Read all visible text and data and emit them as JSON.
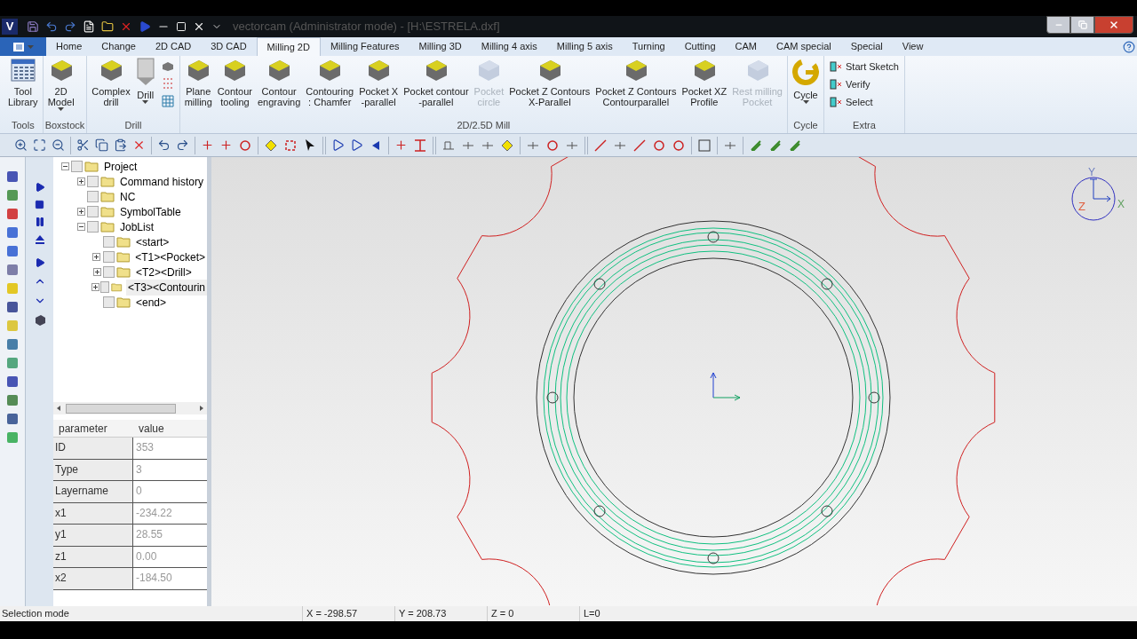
{
  "title_bar": {
    "app_letter": "V",
    "title": "vectorcam (Administrator mode) - [H:\\ESTRELA.dxf]"
  },
  "tabs": [
    {
      "label": "Home",
      "selected": false
    },
    {
      "label": "Change",
      "selected": false
    },
    {
      "label": "2D CAD",
      "selected": false
    },
    {
      "label": "3D CAD",
      "selected": false
    },
    {
      "label": "Milling 2D",
      "selected": true
    },
    {
      "label": "Milling Features",
      "selected": false
    },
    {
      "label": "Milling 3D",
      "selected": false
    },
    {
      "label": "Milling 4 axis",
      "selected": false
    },
    {
      "label": "Milling 5 axis",
      "selected": false
    },
    {
      "label": "Turning",
      "selected": false
    },
    {
      "label": "Cutting",
      "selected": false
    },
    {
      "label": "CAM",
      "selected": false
    },
    {
      "label": "CAM special",
      "selected": false
    },
    {
      "label": "Special",
      "selected": false
    },
    {
      "label": "View",
      "selected": false
    }
  ],
  "ribbon": [
    {
      "label": "Tools",
      "buttons": [
        {
          "kind": "large",
          "lines": [
            "Tool",
            "Library"
          ],
          "disabled": false,
          "dropdown": false
        }
      ]
    },
    {
      "label": "Boxstock",
      "buttons": [
        {
          "kind": "large",
          "lines": [
            "2D",
            "Model"
          ],
          "disabled": false,
          "dropdown": true
        }
      ]
    },
    {
      "label": "Drill",
      "buttons": [
        {
          "kind": "large",
          "lines": [
            "Complex",
            "drill"
          ],
          "disabled": false,
          "dropdown": false
        },
        {
          "kind": "large",
          "lines": [
            "Drill"
          ],
          "disabled": false,
          "dropdown": true
        },
        {
          "kind": "icons"
        }
      ]
    },
    {
      "label": "2D/2.5D Mill",
      "buttons": [
        {
          "kind": "large",
          "lines": [
            "Plane",
            "milling"
          ],
          "disabled": false,
          "dropdown": false
        },
        {
          "kind": "large",
          "lines": [
            "Contour",
            "tooling"
          ],
          "disabled": false,
          "dropdown": false
        },
        {
          "kind": "large",
          "lines": [
            "Contour",
            "engraving"
          ],
          "disabled": false,
          "dropdown": false
        },
        {
          "kind": "large",
          "lines": [
            "Contouring",
            ": Chamfer"
          ],
          "disabled": false,
          "dropdown": false
        },
        {
          "kind": "large",
          "lines": [
            "Pocket X",
            "-parallel"
          ],
          "disabled": false,
          "dropdown": false
        },
        {
          "kind": "large",
          "lines": [
            "Pocket contour",
            "-parallel"
          ],
          "disabled": false,
          "dropdown": false
        },
        {
          "kind": "large",
          "lines": [
            "Pocket",
            "circle"
          ],
          "disabled": true,
          "dropdown": false
        },
        {
          "kind": "large",
          "lines": [
            "Pocket Z Contours",
            "X-Parallel"
          ],
          "disabled": false,
          "dropdown": false
        },
        {
          "kind": "large",
          "lines": [
            "Pocket Z Contours",
            "Contourparallel"
          ],
          "disabled": false,
          "dropdown": false
        },
        {
          "kind": "large",
          "lines": [
            "Pocket XZ",
            "Profile"
          ],
          "disabled": false,
          "dropdown": false
        },
        {
          "kind": "large",
          "lines": [
            "Rest milling",
            "Pocket"
          ],
          "disabled": true,
          "dropdown": false
        }
      ]
    },
    {
      "label": "Cycle",
      "buttons": [
        {
          "kind": "cycle",
          "lines": [
            "Cycle"
          ],
          "disabled": false,
          "dropdown": true
        }
      ]
    },
    {
      "label": "Extra",
      "buttons": [
        {
          "kind": "small",
          "lines": [
            "Start Sketch"
          ],
          "disabled": false
        },
        {
          "kind": "small",
          "lines": [
            "Verify"
          ],
          "disabled": false
        },
        {
          "kind": "small",
          "lines": [
            "Select"
          ],
          "disabled": false
        }
      ]
    }
  ],
  "tree": [
    {
      "label": "Project",
      "kind": "expanded",
      "checked": false,
      "selected": false,
      "children": [
        {
          "label": "Command history",
          "kind": "collapsed",
          "checked": false,
          "selected": false
        },
        {
          "label": "NC",
          "kind": "leaf",
          "checked": false,
          "selected": false
        },
        {
          "label": "SymbolTable",
          "kind": "collapsed",
          "checked": false,
          "selected": false
        },
        {
          "label": "JobList",
          "kind": "expanded",
          "checked": false,
          "selected": false,
          "children": [
            {
              "label": "<start>",
              "kind": "leaf",
              "checked": false,
              "selected": false
            },
            {
              "label": "<T1><Pocket>",
              "kind": "collapsed",
              "checked": false,
              "selected": false
            },
            {
              "label": "<T2><Drill>",
              "kind": "collapsed",
              "checked": false,
              "selected": false
            },
            {
              "label": "<T3><Contourin",
              "kind": "collapsed",
              "checked": false,
              "selected": true
            },
            {
              "label": "<end>",
              "kind": "leaf",
              "checked": false,
              "selected": false
            }
          ]
        }
      ]
    }
  ],
  "properties": {
    "columns": [
      "parameter",
      "value"
    ],
    "rows": [
      {
        "parameter": "ID",
        "value": "353"
      },
      {
        "parameter": "Type",
        "value": "3"
      },
      {
        "parameter": "Layername",
        "value": "0"
      },
      {
        "parameter": "x1",
        "value": "-234.22"
      },
      {
        "parameter": "y1",
        "value": "28.55"
      },
      {
        "parameter": "z1",
        "value": "0.00"
      },
      {
        "parameter": "x2",
        "value": "-184.50"
      }
    ]
  },
  "gizmo": {
    "y": "Y",
    "z": "Z",
    "x": "X"
  },
  "status_bar": [
    "Selection mode",
    "X = -298.57",
    "Y = 208.73",
    "Z = 0",
    "L=0"
  ]
}
